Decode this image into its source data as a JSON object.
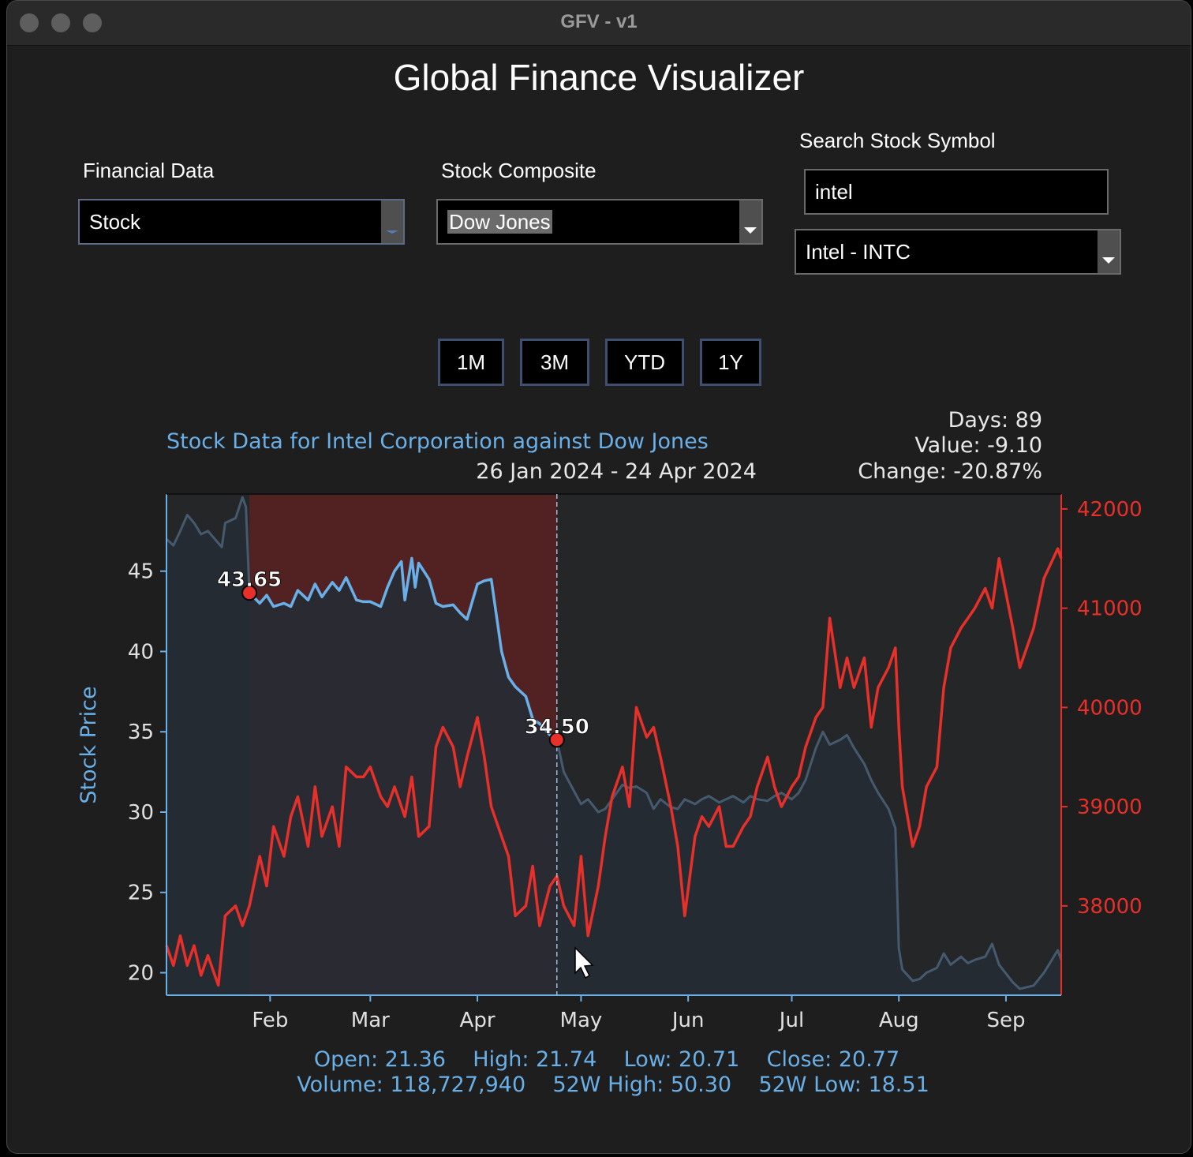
{
  "window": {
    "title": "GFV - v1"
  },
  "app": {
    "title": "Global Finance Visualizer"
  },
  "controls": {
    "financial_data": {
      "label": "Financial Data",
      "value": "Stock"
    },
    "stock_composite": {
      "label": "Stock Composite",
      "value": "Dow Jones"
    },
    "search": {
      "label": "Search Stock Symbol",
      "value": "intel",
      "result": "Intel - INTC"
    }
  },
  "range_buttons": [
    "1M",
    "3M",
    "YTD",
    "1Y"
  ],
  "chart_data": {
    "type": "line",
    "title": "Stock Data for Intel Corporation against Dow Jones",
    "date_range": "26 Jan 2024 - 24 Apr 2024",
    "stats": {
      "days": "Days: 89",
      "value": "Value: -9.10",
      "change": "Change: -20.87%"
    },
    "ylabel_left": "Stock Price",
    "x_tick_labels": [
      "Feb",
      "Mar",
      "Apr",
      "May",
      "Jun",
      "Jul",
      "Aug",
      "Sep"
    ],
    "x_ticks": [
      "2024-02-01",
      "2024-03-01",
      "2024-04-01",
      "2024-05-01",
      "2024-06-01",
      "2024-07-01",
      "2024-08-01",
      "2024-09-01"
    ],
    "x_range": [
      "2024-01-02",
      "2024-09-17"
    ],
    "y_left": {
      "ticks": [
        20,
        25,
        30,
        35,
        40,
        45
      ],
      "range": [
        18.6,
        49.8
      ]
    },
    "y_right": {
      "ticks": [
        38000,
        39000,
        40000,
        41000,
        42000
      ],
      "tick_labels": [
        "38000",
        "39000",
        "40000",
        "41000",
        "42000"
      ],
      "range": [
        37100,
        42150
      ]
    },
    "selection": {
      "start": "2024-01-26",
      "end": "2024-04-24",
      "start_label": "43.65",
      "end_label": "34.50",
      "start_value": 43.65,
      "end_value": 34.5
    },
    "series": [
      {
        "axis": "left",
        "color": "#6ab0e8",
        "points": [
          [
            "2024-01-02",
            47.0
          ],
          [
            "2024-01-04",
            46.6
          ],
          [
            "2024-01-06",
            47.5
          ],
          [
            "2024-01-08",
            48.5
          ],
          [
            "2024-01-10",
            48.0
          ],
          [
            "2024-01-12",
            47.3
          ],
          [
            "2024-01-14",
            47.5
          ],
          [
            "2024-01-16",
            47.0
          ],
          [
            "2024-01-18",
            46.5
          ],
          [
            "2024-01-19",
            48.0
          ],
          [
            "2024-01-22",
            48.3
          ],
          [
            "2024-01-24",
            49.6
          ],
          [
            "2024-01-25",
            49.0
          ],
          [
            "2024-01-26",
            43.65
          ],
          [
            "2024-01-29",
            43.0
          ],
          [
            "2024-01-31",
            43.5
          ],
          [
            "2024-02-02",
            42.8
          ],
          [
            "2024-02-05",
            43.0
          ],
          [
            "2024-02-07",
            42.8
          ],
          [
            "2024-02-09",
            43.8
          ],
          [
            "2024-02-12",
            43.2
          ],
          [
            "2024-02-14",
            44.2
          ],
          [
            "2024-02-16",
            43.4
          ],
          [
            "2024-02-19",
            44.3
          ],
          [
            "2024-02-21",
            43.8
          ],
          [
            "2024-02-23",
            44.6
          ],
          [
            "2024-02-26",
            43.2
          ],
          [
            "2024-02-28",
            43.1
          ],
          [
            "2024-03-01",
            43.1
          ],
          [
            "2024-03-04",
            42.8
          ],
          [
            "2024-03-06",
            44.0
          ],
          [
            "2024-03-08",
            45.0
          ],
          [
            "2024-03-10",
            45.6
          ],
          [
            "2024-03-11",
            43.2
          ],
          [
            "2024-03-13",
            45.8
          ],
          [
            "2024-03-14",
            44.0
          ],
          [
            "2024-03-15",
            45.5
          ],
          [
            "2024-03-18",
            44.5
          ],
          [
            "2024-03-20",
            43.0
          ],
          [
            "2024-03-22",
            42.8
          ],
          [
            "2024-03-25",
            42.9
          ],
          [
            "2024-03-27",
            42.4
          ],
          [
            "2024-03-29",
            42.0
          ],
          [
            "2024-04-01",
            44.2
          ],
          [
            "2024-04-03",
            44.4
          ],
          [
            "2024-04-05",
            44.5
          ],
          [
            "2024-04-08",
            40.0
          ],
          [
            "2024-04-10",
            38.4
          ],
          [
            "2024-04-12",
            37.8
          ],
          [
            "2024-04-15",
            37.2
          ],
          [
            "2024-04-17",
            35.8
          ],
          [
            "2024-04-19",
            35.5
          ],
          [
            "2024-04-22",
            34.8
          ],
          [
            "2024-04-24",
            34.5
          ],
          [
            "2024-04-26",
            32.5
          ],
          [
            "2024-04-29",
            31.3
          ],
          [
            "2024-05-01",
            30.5
          ],
          [
            "2024-05-03",
            30.8
          ],
          [
            "2024-05-06",
            30.0
          ],
          [
            "2024-05-08",
            30.2
          ],
          [
            "2024-05-10",
            30.8
          ],
          [
            "2024-05-13",
            31.7
          ],
          [
            "2024-05-15",
            31.5
          ],
          [
            "2024-05-17",
            31.6
          ],
          [
            "2024-05-20",
            31.2
          ],
          [
            "2024-05-22",
            30.2
          ],
          [
            "2024-05-24",
            30.8
          ],
          [
            "2024-05-27",
            30.3
          ],
          [
            "2024-05-29",
            30.2
          ],
          [
            "2024-05-31",
            30.8
          ],
          [
            "2024-06-03",
            30.5
          ],
          [
            "2024-06-05",
            30.8
          ],
          [
            "2024-06-07",
            31.0
          ],
          [
            "2024-06-10",
            30.6
          ],
          [
            "2024-06-12",
            30.8
          ],
          [
            "2024-06-14",
            31.0
          ],
          [
            "2024-06-17",
            30.6
          ],
          [
            "2024-06-19",
            31.0
          ],
          [
            "2024-06-21",
            30.8
          ],
          [
            "2024-06-24",
            30.7
          ],
          [
            "2024-06-26",
            31.0
          ],
          [
            "2024-06-28",
            31.2
          ],
          [
            "2024-07-01",
            30.8
          ],
          [
            "2024-07-03",
            31.2
          ],
          [
            "2024-07-05",
            32.0
          ],
          [
            "2024-07-08",
            34.0
          ],
          [
            "2024-07-10",
            35.0
          ],
          [
            "2024-07-12",
            34.2
          ],
          [
            "2024-07-15",
            34.5
          ],
          [
            "2024-07-17",
            34.8
          ],
          [
            "2024-07-19",
            34.0
          ],
          [
            "2024-07-22",
            33.0
          ],
          [
            "2024-07-24",
            32.0
          ],
          [
            "2024-07-26",
            31.2
          ],
          [
            "2024-07-29",
            30.2
          ],
          [
            "2024-07-31",
            29.0
          ],
          [
            "2024-08-01",
            21.5
          ],
          [
            "2024-08-02",
            20.2
          ],
          [
            "2024-08-05",
            19.5
          ],
          [
            "2024-08-07",
            19.6
          ],
          [
            "2024-08-09",
            20.0
          ],
          [
            "2024-08-12",
            20.3
          ],
          [
            "2024-08-14",
            21.2
          ],
          [
            "2024-08-16",
            20.5
          ],
          [
            "2024-08-19",
            21.0
          ],
          [
            "2024-08-21",
            20.6
          ],
          [
            "2024-08-23",
            20.8
          ],
          [
            "2024-08-26",
            21.0
          ],
          [
            "2024-08-28",
            21.8
          ],
          [
            "2024-08-30",
            20.5
          ],
          [
            "2024-09-03",
            19.4
          ],
          [
            "2024-09-05",
            19.0
          ],
          [
            "2024-09-09",
            19.2
          ],
          [
            "2024-09-12",
            20.0
          ],
          [
            "2024-09-16",
            21.4
          ],
          [
            "2024-09-17",
            20.8
          ]
        ]
      },
      {
        "axis": "right",
        "color": "#e8302a",
        "points": [
          [
            "2024-01-02",
            37.6
          ],
          [
            "2024-01-04",
            37.4
          ],
          [
            "2024-01-06",
            37.7
          ],
          [
            "2024-01-08",
            37.4
          ],
          [
            "2024-01-10",
            37.6
          ],
          [
            "2024-01-12",
            37.3
          ],
          [
            "2024-01-14",
            37.5
          ],
          [
            "2024-01-17",
            37.2
          ],
          [
            "2024-01-19",
            37.9
          ],
          [
            "2024-01-22",
            38.0
          ],
          [
            "2024-01-24",
            37.8
          ],
          [
            "2024-01-26",
            38.0
          ],
          [
            "2024-01-29",
            38.5
          ],
          [
            "2024-01-31",
            38.2
          ],
          [
            "2024-02-02",
            38.8
          ],
          [
            "2024-02-05",
            38.5
          ],
          [
            "2024-02-07",
            38.9
          ],
          [
            "2024-02-09",
            39.1
          ],
          [
            "2024-02-12",
            38.6
          ],
          [
            "2024-02-14",
            39.2
          ],
          [
            "2024-02-16",
            38.7
          ],
          [
            "2024-02-19",
            39.0
          ],
          [
            "2024-02-21",
            38.6
          ],
          [
            "2024-02-23",
            39.4
          ],
          [
            "2024-02-26",
            39.3
          ],
          [
            "2024-02-28",
            39.3
          ],
          [
            "2024-03-01",
            39.4
          ],
          [
            "2024-03-04",
            39.1
          ],
          [
            "2024-03-06",
            39.0
          ],
          [
            "2024-03-08",
            39.2
          ],
          [
            "2024-03-11",
            38.9
          ],
          [
            "2024-03-13",
            39.3
          ],
          [
            "2024-03-15",
            38.7
          ],
          [
            "2024-03-18",
            38.8
          ],
          [
            "2024-03-20",
            39.6
          ],
          [
            "2024-03-22",
            39.8
          ],
          [
            "2024-03-25",
            39.6
          ],
          [
            "2024-03-27",
            39.2
          ],
          [
            "2024-03-29",
            39.5
          ],
          [
            "2024-04-01",
            39.9
          ],
          [
            "2024-04-03",
            39.5
          ],
          [
            "2024-04-05",
            39.0
          ],
          [
            "2024-04-08",
            38.7
          ],
          [
            "2024-04-10",
            38.5
          ],
          [
            "2024-04-12",
            37.9
          ],
          [
            "2024-04-15",
            38.0
          ],
          [
            "2024-04-17",
            38.4
          ],
          [
            "2024-04-19",
            37.8
          ],
          [
            "2024-04-22",
            38.2
          ],
          [
            "2024-04-24",
            38.3
          ],
          [
            "2024-04-26",
            38.0
          ],
          [
            "2024-04-29",
            37.8
          ],
          [
            "2024-05-01",
            38.5
          ],
          [
            "2024-05-03",
            37.7
          ],
          [
            "2024-05-06",
            38.2
          ],
          [
            "2024-05-08",
            38.7
          ],
          [
            "2024-05-10",
            39.1
          ],
          [
            "2024-05-13",
            39.4
          ],
          [
            "2024-05-15",
            39.0
          ],
          [
            "2024-05-17",
            40.0
          ],
          [
            "2024-05-20",
            39.7
          ],
          [
            "2024-05-22",
            39.8
          ],
          [
            "2024-05-24",
            39.5
          ],
          [
            "2024-05-27",
            39.0
          ],
          [
            "2024-05-29",
            38.6
          ],
          [
            "2024-05-31",
            37.9
          ],
          [
            "2024-06-03",
            38.7
          ],
          [
            "2024-06-05",
            38.9
          ],
          [
            "2024-06-07",
            38.8
          ],
          [
            "2024-06-10",
            39.0
          ],
          [
            "2024-06-12",
            38.6
          ],
          [
            "2024-06-14",
            38.6
          ],
          [
            "2024-06-17",
            38.8
          ],
          [
            "2024-06-19",
            38.9
          ],
          [
            "2024-06-21",
            39.2
          ],
          [
            "2024-06-24",
            39.5
          ],
          [
            "2024-06-26",
            39.2
          ],
          [
            "2024-06-28",
            39.0
          ],
          [
            "2024-07-01",
            39.2
          ],
          [
            "2024-07-03",
            39.3
          ],
          [
            "2024-07-05",
            39.6
          ],
          [
            "2024-07-08",
            39.9
          ],
          [
            "2024-07-10",
            40.0
          ],
          [
            "2024-07-12",
            40.9
          ],
          [
            "2024-07-15",
            40.2
          ],
          [
            "2024-07-17",
            40.5
          ],
          [
            "2024-07-19",
            40.2
          ],
          [
            "2024-07-22",
            40.5
          ],
          [
            "2024-07-24",
            39.8
          ],
          [
            "2024-07-26",
            40.2
          ],
          [
            "2024-07-29",
            40.4
          ],
          [
            "2024-07-31",
            40.6
          ],
          [
            "2024-08-01",
            39.8
          ],
          [
            "2024-08-02",
            39.2
          ],
          [
            "2024-08-05",
            38.6
          ],
          [
            "2024-08-07",
            38.8
          ],
          [
            "2024-08-09",
            39.2
          ],
          [
            "2024-08-12",
            39.4
          ],
          [
            "2024-08-14",
            40.2
          ],
          [
            "2024-08-16",
            40.6
          ],
          [
            "2024-08-19",
            40.8
          ],
          [
            "2024-08-21",
            40.9
          ],
          [
            "2024-08-23",
            41.0
          ],
          [
            "2024-08-26",
            41.2
          ],
          [
            "2024-08-28",
            41.0
          ],
          [
            "2024-08-30",
            41.5
          ],
          [
            "2024-09-03",
            40.8
          ],
          [
            "2024-09-05",
            40.4
          ],
          [
            "2024-09-09",
            40.8
          ],
          [
            "2024-09-12",
            41.3
          ],
          [
            "2024-09-16",
            41.6
          ],
          [
            "2024-09-17",
            41.5
          ]
        ]
      }
    ],
    "footer": {
      "line1": "Open: 21.36    High: 21.74    Low: 20.71    Close: 20.77",
      "line2": "Volume: 118,727,940    52W High: 50.30    52W Low: 18.51"
    },
    "colors": {
      "left_axis": "#6ab0e8",
      "right_axis": "#e8302a",
      "selection_fill": "#5a2222",
      "plot_bg": "#252628",
      "marker": "#e8302a"
    }
  }
}
